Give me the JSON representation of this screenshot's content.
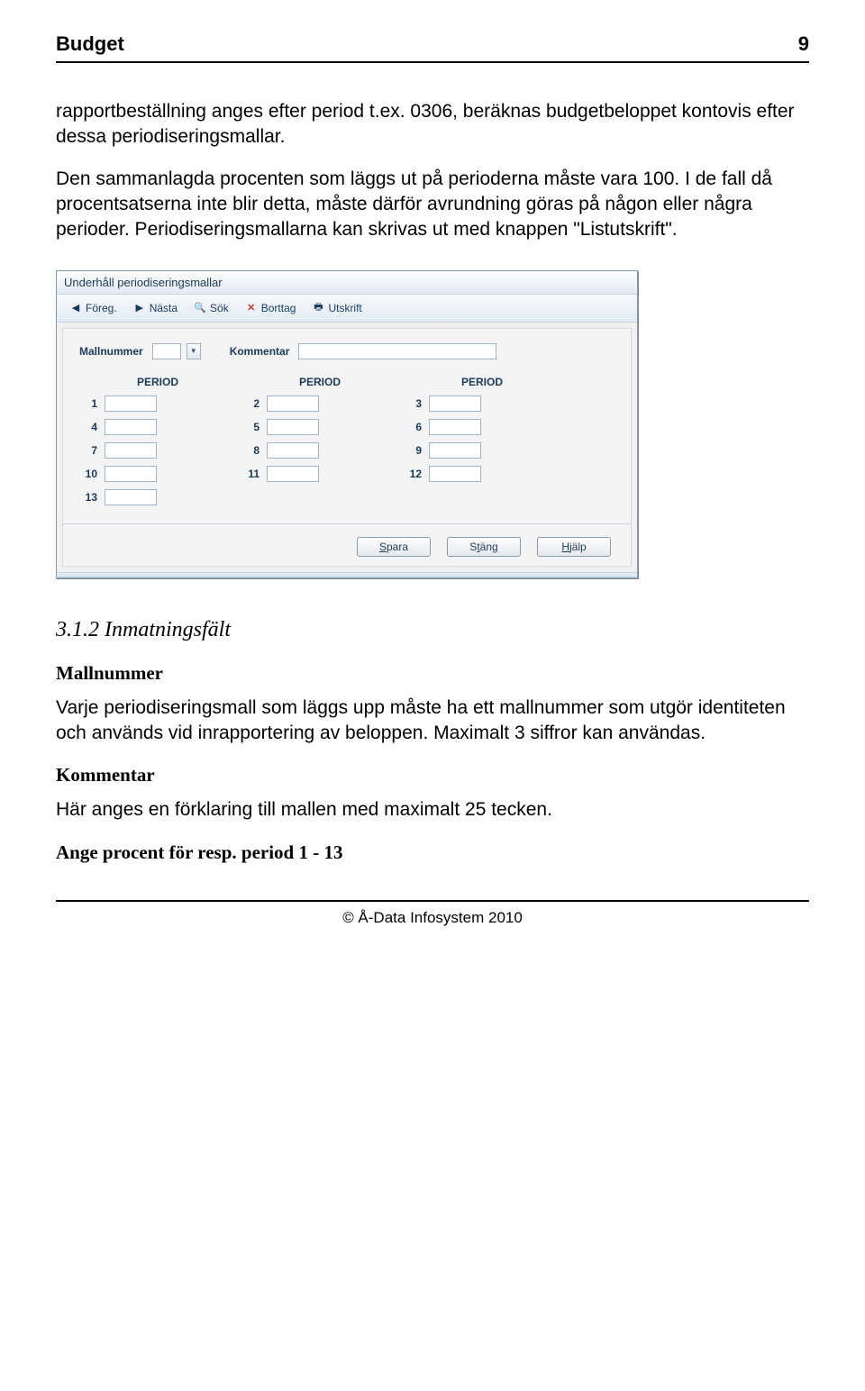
{
  "header": {
    "left": "Budget",
    "right": "9"
  },
  "paragraphs": {
    "p1": "rapportbeställning anges efter period t.ex. 0306, beräknas budgetbeloppet kontovis efter dessa periodiseringsmallar.",
    "p2": "Den sammanlagda procenten som läggs ut på perioderna måste vara 100. I de fall då procentsatserna inte blir detta, måste därför avrundning göras på någon eller några perioder. Periodiseringsmallarna kan skrivas ut med knappen \"Listutskrift\"."
  },
  "dialog": {
    "title": "Underhåll periodiseringsmallar",
    "toolbar": {
      "prev": "Föreg.",
      "next": "Nästa",
      "search": "Sök",
      "delete": "Borttag",
      "print": "Utskrift"
    },
    "labels": {
      "mallnummer": "Mallnummer",
      "kommentar": "Kommentar",
      "period": "PERIOD"
    },
    "periods": [
      "1",
      "2",
      "3",
      "4",
      "5",
      "6",
      "7",
      "8",
      "9",
      "10",
      "11",
      "12",
      "13"
    ],
    "buttons": {
      "save": "Spara",
      "close": "Stäng",
      "help": "Hjälp"
    }
  },
  "section": {
    "heading": "3.1.2 Inmatningsfält",
    "sub1_title": "Mallnummer",
    "sub1_body": "Varje periodiseringsmall som läggs upp måste ha ett mallnummer som utgör identiteten och används vid inrapportering av beloppen. Maximalt 3 siffror kan användas.",
    "sub2_title": "Kommentar",
    "sub2_body": "Här anges en förklaring till mallen med maximalt 25 tecken.",
    "sub3_title": "Ange procent för resp. period 1 - 13"
  },
  "footer": "© Å-Data Infosystem 2010"
}
